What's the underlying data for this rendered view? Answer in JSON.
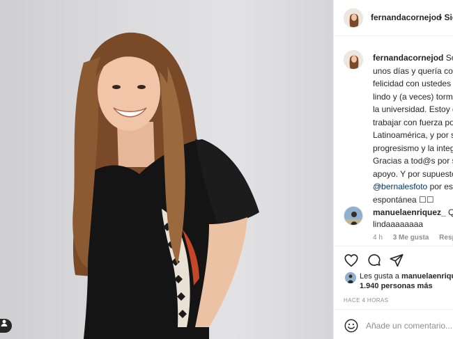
{
  "header": {
    "username": "fernandacornejod",
    "follow_label": "• Sig"
  },
  "caption": {
    "username": "fernandacornejod",
    "lines": [
      "Soy",
      "unos días y quería com",
      "felicidad con ustedes d",
      "lindo y (a veces) tormen",
      "la universidad. Estoy di",
      "trabajar con fuerza por",
      "Latinoamérica, y por su",
      "progresismo y la integr",
      "Gracias a tod@s por su",
      "apoyo. Y por supuesto"
    ],
    "mention": "@bernalesfoto",
    "mention_tail": " por esta",
    "last_line": "espontánea ☐☐",
    "time": "4 h"
  },
  "comment": {
    "username": "manuelaenriquez_",
    "text_inline": " Que",
    "text_line2": "lindaaaaaaaa",
    "time": "4 h",
    "likes": "3 Me gusta",
    "reply": "Respon"
  },
  "likes": {
    "prefix": "Les gusta a ",
    "user": "manuelaenriqu",
    "others": "1.940 personas más"
  },
  "post_time": "HACE 4 HORAS",
  "add_comment": {
    "placeholder": "Añade un comentario..."
  },
  "icons": {
    "like": "heart-icon",
    "comment": "comment-bubble-icon",
    "share": "paper-plane-icon",
    "emoji": "emoji-smile-icon",
    "tag": "user-tag-icon"
  },
  "colors": {
    "link": "#00376b",
    "muted": "#8e8e8e",
    "text": "#262626",
    "divider": "#efefef"
  }
}
